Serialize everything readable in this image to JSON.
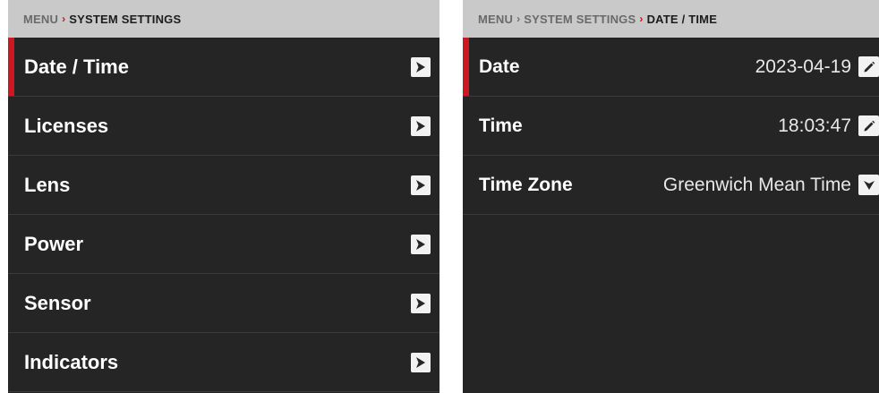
{
  "left": {
    "breadcrumb": {
      "root": "MENU",
      "separator": "›",
      "current": "SYSTEM SETTINGS"
    },
    "items": [
      {
        "label": "Date / Time"
      },
      {
        "label": "Licenses"
      },
      {
        "label": "Lens"
      },
      {
        "label": "Power"
      },
      {
        "label": "Sensor"
      },
      {
        "label": "Indicators"
      }
    ]
  },
  "right": {
    "breadcrumb": {
      "root": "MENU",
      "separator": "›",
      "middle": "SYSTEM SETTINGS",
      "current": "DATE / TIME"
    },
    "rows": [
      {
        "label": "Date",
        "value": "2023-04-19"
      },
      {
        "label": "Time",
        "value": "18:03:47"
      },
      {
        "label": "Time Zone",
        "value": "Greenwich Mean Time"
      }
    ]
  },
  "colors": {
    "accent_red": "#cc1820",
    "panel_bg": "#252525",
    "header_bg": "#c9c9c9"
  },
  "icons": {
    "submenu": "chevron-right-icon",
    "edit": "pencil-icon",
    "dropdown": "chevron-down-icon"
  }
}
